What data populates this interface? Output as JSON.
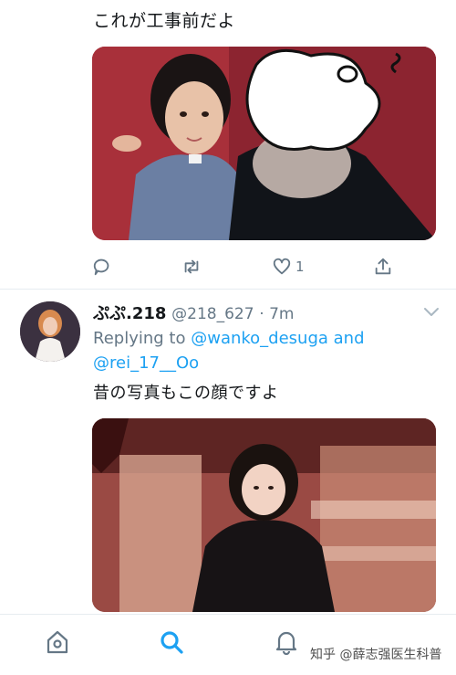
{
  "tweet1": {
    "text": "これが工事前だよ",
    "like_count": "1"
  },
  "tweet2": {
    "display_name": "ぷぷ.218",
    "handle": "@218_627",
    "time": "· 7m",
    "replying_prefix": "Replying to",
    "mention1": "@wanko_desuga",
    "and_text": "and",
    "mention2": "@rei_17__Oo",
    "text": "昔の写真もこの顔ですよ"
  },
  "nav": {
    "watermark": "知乎 @薛志强医生科普"
  },
  "colors": {
    "accent": "#1da1f2",
    "secondary_text": "#657786",
    "divider": "#e6ecf0"
  },
  "icons": [
    "reply-icon",
    "retweet-icon",
    "like-icon",
    "share-icon",
    "chevron-down-icon",
    "home-icon",
    "search-icon",
    "notifications-icon"
  ]
}
